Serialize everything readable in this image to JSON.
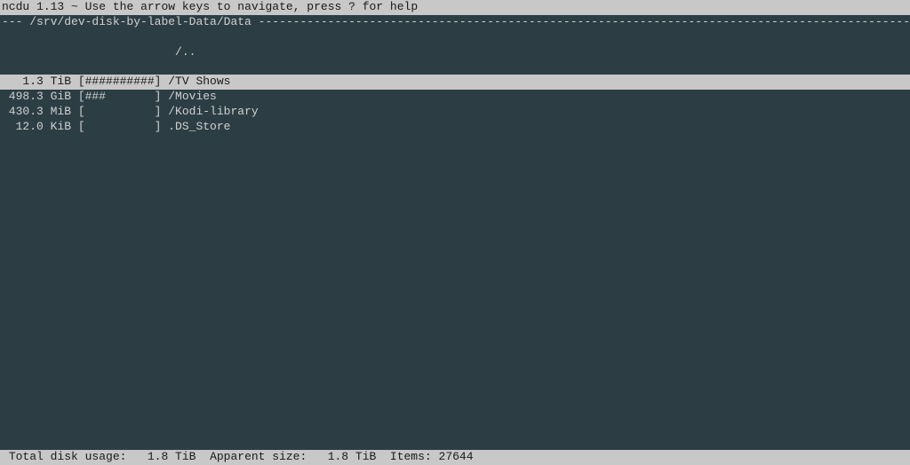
{
  "header": {
    "program": "ncdu",
    "version": "1.13",
    "help_text": "Use the arrow keys to navigate, press ? for help"
  },
  "path": {
    "prefix": "---",
    "current": "/srv/dev-disk-by-label-Data/Data"
  },
  "parent_row": {
    "label": "/.."
  },
  "rows": [
    {
      "size": "1.3 TiB",
      "bar": "##########",
      "name": "/TV Shows",
      "selected": true
    },
    {
      "size": "498.3 GiB",
      "bar": "###       ",
      "name": "/Movies",
      "selected": false
    },
    {
      "size": "430.3 MiB",
      "bar": "          ",
      "name": "/Kodi-library",
      "selected": false
    },
    {
      "size": "12.0 KiB",
      "bar": "          ",
      "name": ".DS_Store",
      "selected": false
    }
  ],
  "footer": {
    "total_label": "Total disk usage:",
    "total_value": "1.8 TiB",
    "apparent_label": "Apparent size:",
    "apparent_value": "1.8 TiB",
    "items_label": "Items:",
    "items_value": "27644"
  }
}
